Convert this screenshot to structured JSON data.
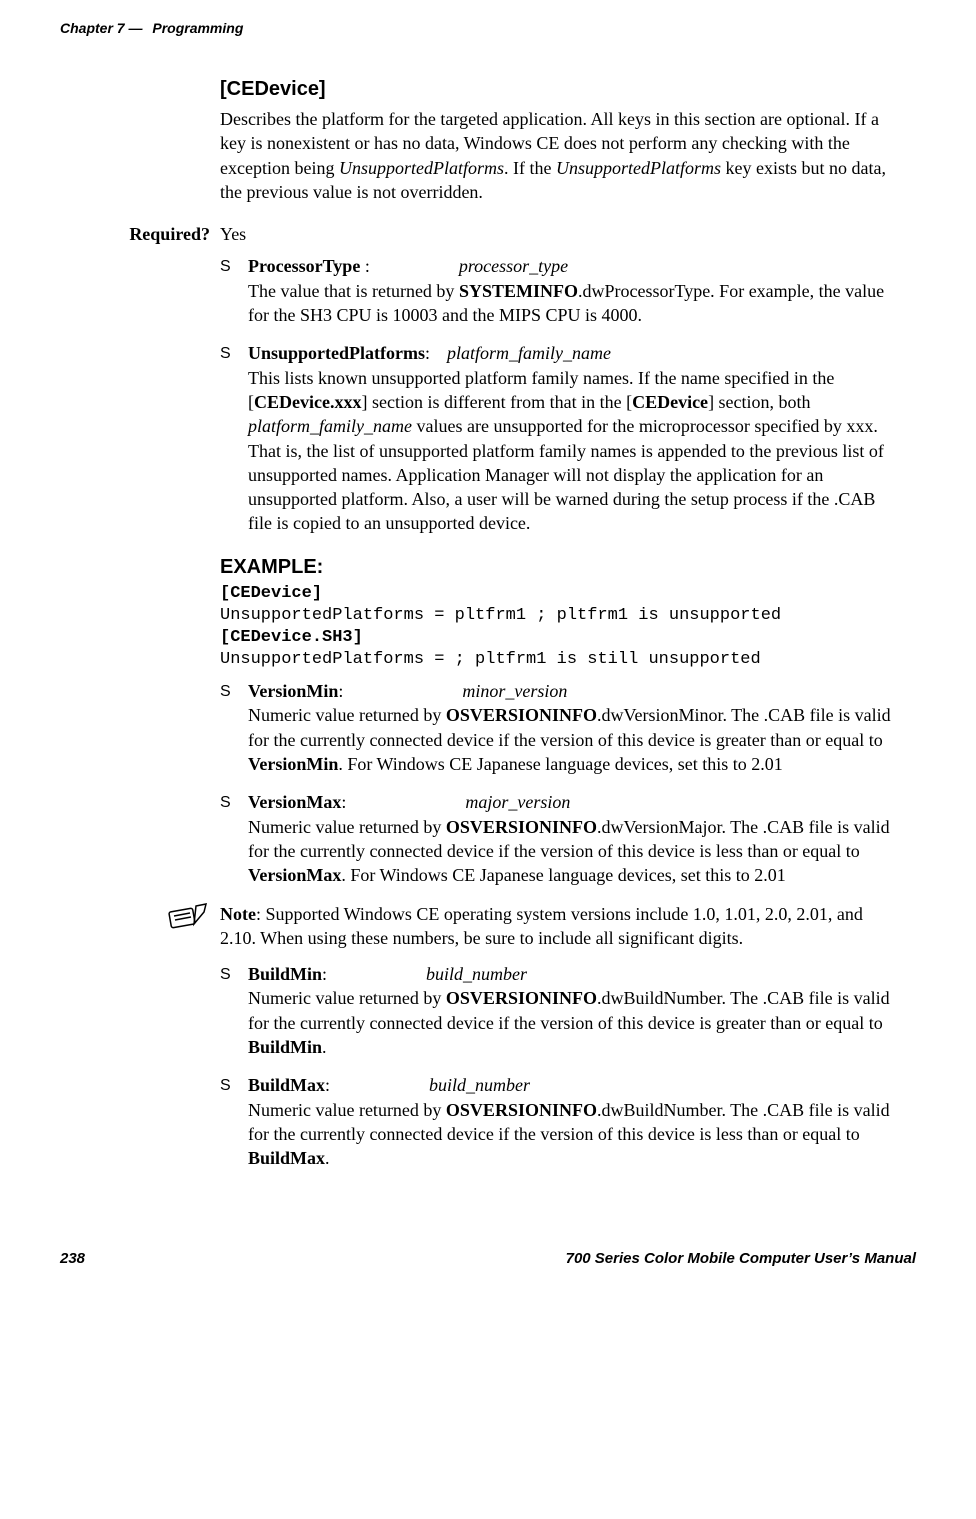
{
  "header": {
    "chapter": "Chapter 7",
    "dash": "   —",
    "title": "Programming"
  },
  "cedevice": {
    "heading": "[CEDevice]",
    "desc_p1a": "Describes the platform for the targeted application. All keys in this section are optional. If a key is nonexistent or has no data, Windows CE does not perform any checking with the exception being ",
    "desc_p1b": "UnsupportedPlatforms",
    "desc_p1c": ". If the ",
    "desc_p1d": "UnsupportedPlatforms",
    "desc_p1e": " key exists but no data, the previous value is not overridden."
  },
  "required": {
    "label": "Required?",
    "value": "Yes"
  },
  "keys": {
    "processor": {
      "name": "ProcessorType",
      "sep": " :",
      "param": "processor_type",
      "desc1": "The value that is returned by ",
      "desc2": "SYSTEMINFO",
      "desc3": ".dwProcessorType. For example, the value for the SH3 CPU is 10003 and the MIPS CPU is 4000."
    },
    "unsupported": {
      "name": "UnsupportedPlatforms",
      "sep": ":",
      "param": "platform_family_name",
      "d1": "This lists known unsupported platform family names. If the name specified in the [",
      "d2": "CEDevice.xxx",
      "d3": "] section is different from that in the [",
      "d4": "CEDevice",
      "d5": "] section, both ",
      "d6": "platform_family_name",
      "d7": " values are unsupported for the microprocessor specified by xxx. That is, the list of unsupported platform family names is appended to the previous list of unsupported names. Application Manager will not display the application for an unsupported platform. Also, a user will be warned during the setup process if the .CAB file is copied to an unsupported device."
    },
    "vmin": {
      "name": "VersionMin",
      "sep": ":",
      "param": "minor_version",
      "d1": "Numeric value returned by ",
      "d2": "OSVERSIONINFO",
      "d3": ".dwVersionMinor. The .CAB file is valid for the currently connected device if the version of this device is greater than or equal to ",
      "d4": "VersionMin",
      "d5": ". For Windows CE Japanese language devices, set this to 2.01"
    },
    "vmax": {
      "name": "VersionMax",
      "sep": ":",
      "param": "major_version",
      "d1": "Numeric value returned by ",
      "d2": "OSVERSIONINFO",
      "d3": ".dwVersionMajor. The .CAB file is valid for the currently connected device if the version of this device is less than or equal to ",
      "d4": "VersionMax",
      "d5": ". For Windows CE Japanese language devices, set this to 2.01"
    },
    "bmin": {
      "name": "BuildMin",
      "sep": ":",
      "param": "build_number",
      "d1": "Numeric value returned by ",
      "d2": "OSVERSIONINFO",
      "d3": ".dwBuildNumber. The .CAB file is valid for the currently connected device if the version of this device is greater than or equal to ",
      "d4": "BuildMin",
      "d5": "."
    },
    "bmax": {
      "name": "BuildMax",
      "sep": ":",
      "param": "build_number",
      "d1": "Numeric value returned by ",
      "d2": "OSVERSIONINFO",
      "d3": ".dwBuildNumber. The .CAB file is valid for the currently connected device if the version of this device is less than or equal to ",
      "d4": "BuildMax",
      "d5": "."
    }
  },
  "example": {
    "heading": "EXAMPLE:",
    "l1": "[CEDevice]",
    "l2": "UnsupportedPlatforms = pltfrm1 ; pltfrm1 is unsupported",
    "l3": "[CEDevice.SH3]",
    "l4": "UnsupportedPlatforms = ; pltfrm1 is still unsupported"
  },
  "note": {
    "bold": "Note",
    "text": ": Supported Windows CE operating system versions include 1.0, 1.01, 2.0, 2.01, and 2.10. When using these numbers, be sure to include all significant digits."
  },
  "footer": {
    "page": "238",
    "manual": "700 Series Color Mobile Computer User’s Manual"
  }
}
